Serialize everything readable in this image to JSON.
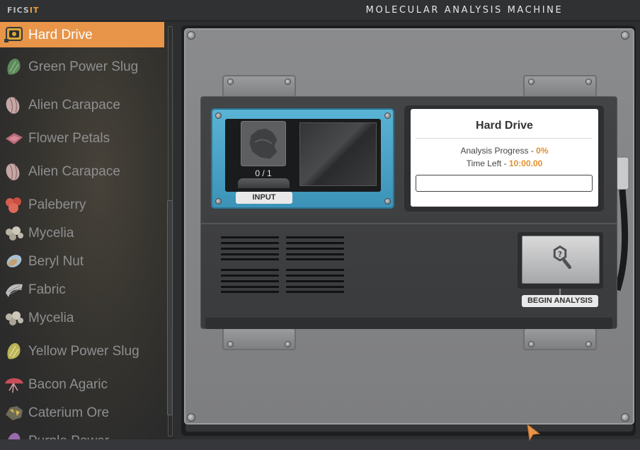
{
  "app": {
    "logo_main": "FICS",
    "logo_accent": "IT",
    "window_title": "MOLECULAR ANALYSIS MACHINE"
  },
  "sidebar": {
    "items": [
      {
        "label": "Hard Drive",
        "icon": "hard-drive-icon",
        "selected": true
      },
      {
        "label": "Green Power Slug",
        "icon": "green-power-slug-icon"
      },
      {
        "label": "Alien Carapace",
        "icon": "alien-carapace-icon"
      },
      {
        "label": "Flower Petals",
        "icon": "flower-petals-icon"
      },
      {
        "label": "Alien Carapace",
        "icon": "alien-carapace-icon"
      },
      {
        "label": "Paleberry",
        "icon": "paleberry-icon"
      },
      {
        "label": "Mycelia",
        "icon": "mycelia-icon"
      },
      {
        "label": "Beryl Nut",
        "icon": "beryl-nut-icon"
      },
      {
        "label": "Fabric",
        "icon": "fabric-icon"
      },
      {
        "label": "Mycelia",
        "icon": "mycelia-icon"
      },
      {
        "label": "Yellow Power Slug",
        "icon": "yellow-power-slug-icon"
      },
      {
        "label": "Bacon Agaric",
        "icon": "bacon-agaric-icon"
      },
      {
        "label": "Caterium Ore",
        "icon": "caterium-ore-icon"
      },
      {
        "label": "Purple Power",
        "icon": "purple-power-slug-icon"
      }
    ]
  },
  "input": {
    "slot_count": "0 / 1",
    "label": "INPUT",
    "slot_icon": "hard-drive-silhouette-icon"
  },
  "info": {
    "title": "Hard Drive",
    "progress_label": "Analysis Progress - ",
    "progress_value": "0%",
    "progress_fraction": 0,
    "time_label": "Time Left - ",
    "time_value": "10:00.00"
  },
  "analysis": {
    "button_label": "BEGIN ANALYSIS",
    "icon": "search-unknown-icon"
  },
  "colors": {
    "accent": "#e8954a",
    "input_panel": "#4aa5c8",
    "value_orange": "#e2902f"
  }
}
